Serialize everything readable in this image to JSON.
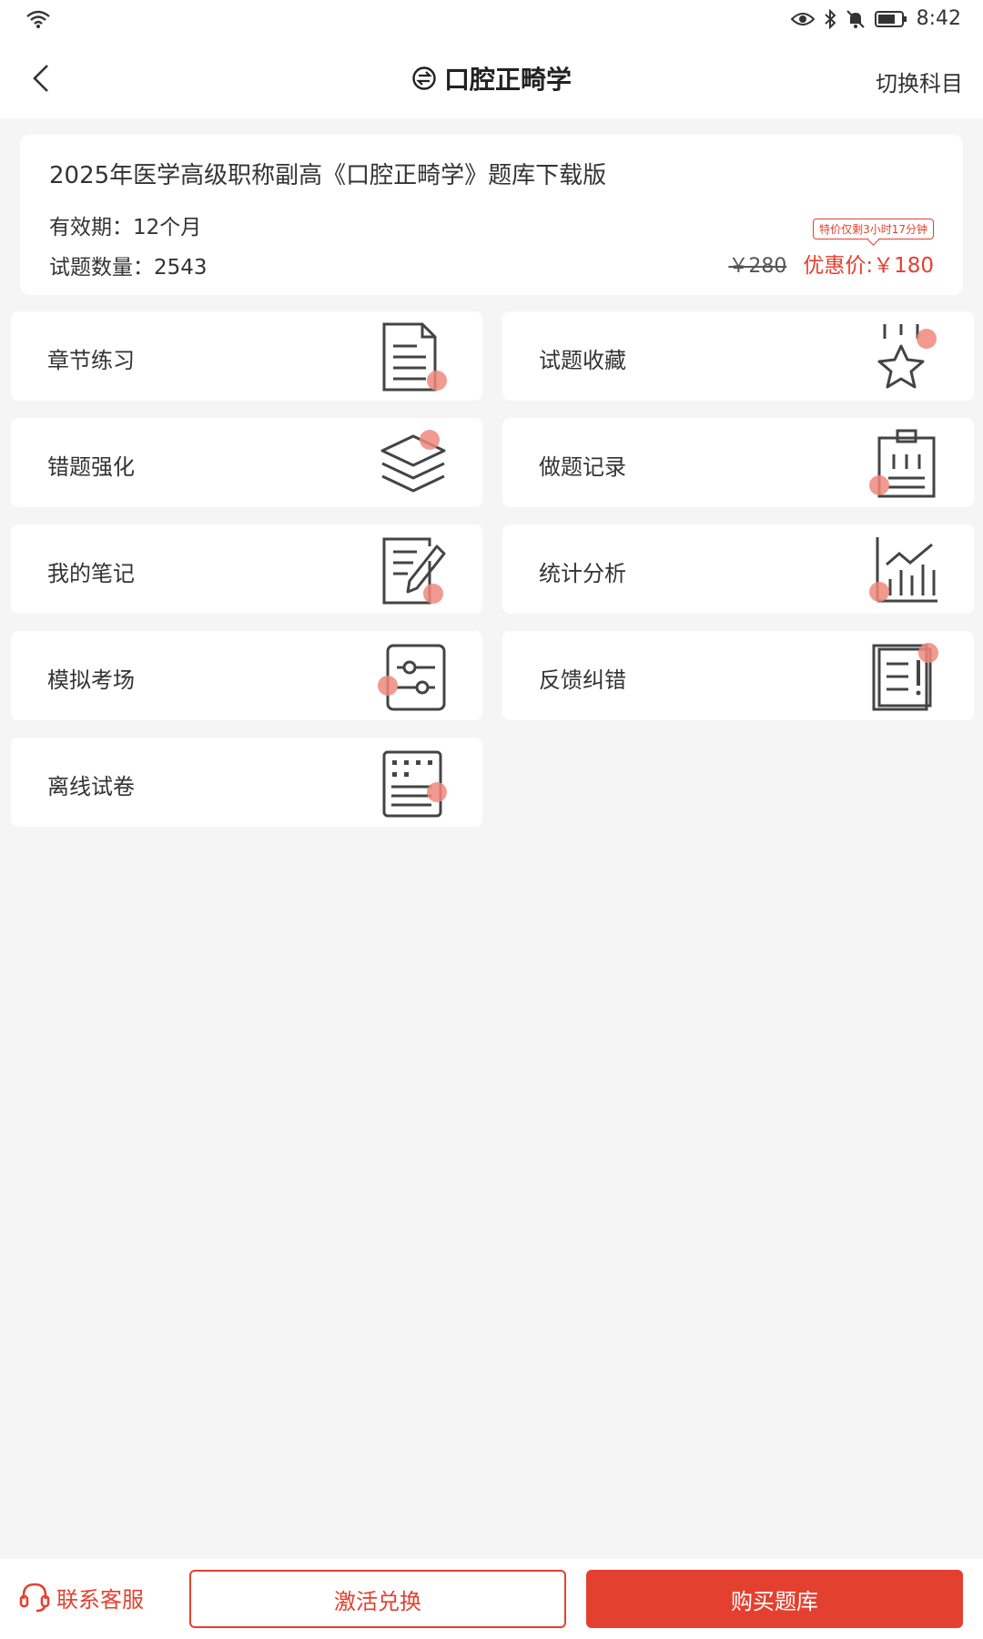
{
  "status_bar": {
    "time": "8:42"
  },
  "nav": {
    "title": "口腔正畸学",
    "switch_label": "切换科目"
  },
  "info": {
    "title": "2025年医学高级职称副高《口腔正畸学》题库下载版",
    "validity": "有效期：12个月",
    "count": "试题数量：2543",
    "promo": "特价仅剩3小时17分钟",
    "price_old": "￥280",
    "price_new": "优惠价:￥180"
  },
  "tiles": [
    {
      "label": "章节练习",
      "icon": "document-icon"
    },
    {
      "label": "试题收藏",
      "icon": "star-icon"
    },
    {
      "label": "错题强化",
      "icon": "layers-icon"
    },
    {
      "label": "做题记录",
      "icon": "clipboard-icon"
    },
    {
      "label": "我的笔记",
      "icon": "note-pen-icon"
    },
    {
      "label": "统计分析",
      "icon": "chart-icon"
    },
    {
      "label": "模拟考场",
      "icon": "sliders-icon"
    },
    {
      "label": "反馈纠错",
      "icon": "feedback-icon"
    },
    {
      "label": "离线试卷",
      "icon": "offline-paper-icon"
    }
  ],
  "bottom": {
    "service": "联系客服",
    "activate": "激活兑换",
    "buy": "购买题库"
  },
  "colors": {
    "accent": "#e4402f",
    "dot": "#f0887c"
  }
}
